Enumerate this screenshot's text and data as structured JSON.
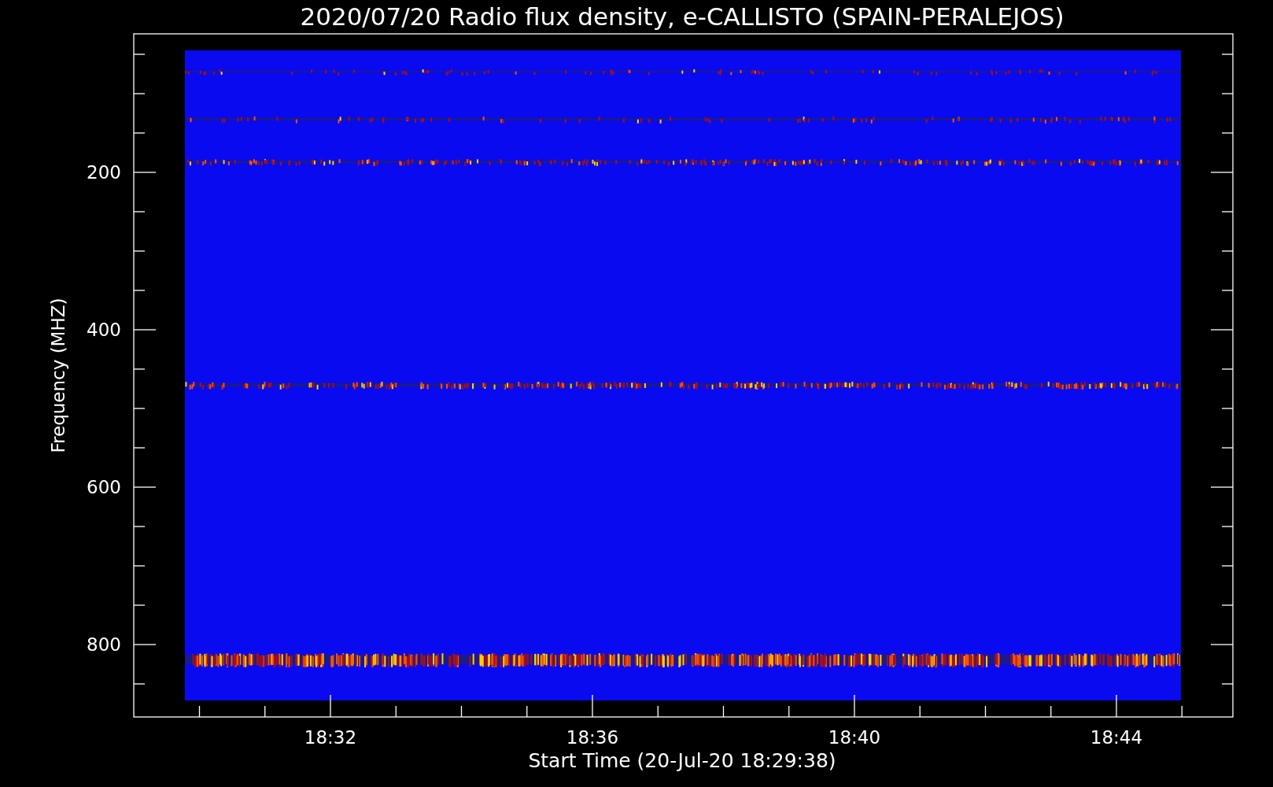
{
  "title": "2020/07/20  Radio flux density, e-CALLISTO (SPAIN-PERALEJOS)",
  "y_axis": {
    "label": "Frequency (MHZ)",
    "ticks": [
      "200",
      "400",
      "600",
      "800"
    ]
  },
  "x_axis": {
    "label": "Start Time (20-Jul-20 18:29:38)",
    "ticks": [
      "18:32",
      "18:36",
      "18:40",
      "18:44"
    ]
  }
}
